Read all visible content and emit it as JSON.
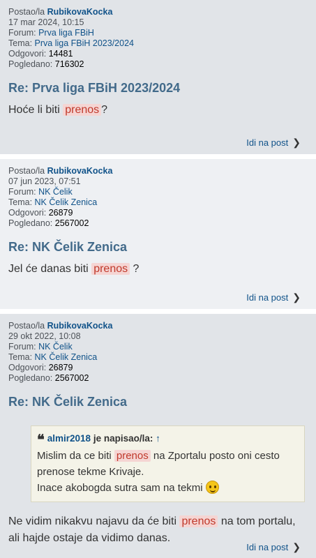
{
  "posts": [
    {
      "author_prefix": "Postao/la",
      "author": "RubikovaKocka",
      "date": "17 mar 2024, 10:15",
      "forum_label": "Forum:",
      "forum": "Prva liga FBiH",
      "topic_label": "Tema:",
      "topic": "Prva liga FBiH 2023/2024",
      "replies_label": "Odgovori:",
      "replies": "14481",
      "views_label": "Pogledano:",
      "views": "716302",
      "title": "Re: Prva liga FBiH 2023/2024",
      "text_before": "Hoće li biti ",
      "highlight": "prenos",
      "text_after": "?",
      "goto": "Idi na post"
    },
    {
      "author_prefix": "Postao/la",
      "author": "RubikovaKocka",
      "date": "07 jun 2023, 07:51",
      "forum_label": "Forum:",
      "forum": "NK Čelik",
      "topic_label": "Tema:",
      "topic": "NK Čelik Zenica",
      "replies_label": "Odgovori:",
      "replies": "26879",
      "views_label": "Pogledano:",
      "views": "2567002",
      "title": "Re: NK Čelik Zenica",
      "text_before": "Jel će danas biti ",
      "highlight": "prenos",
      "text_after": " ?",
      "goto": "Idi na post"
    },
    {
      "author_prefix": "Postao/la",
      "author": "RubikovaKocka",
      "date": "29 okt 2022, 10:08",
      "forum_label": "Forum:",
      "forum": "NK Čelik",
      "topic_label": "Tema:",
      "topic": "NK Čelik Zenica",
      "replies_label": "Odgovori:",
      "replies": "26879",
      "views_label": "Pogledano:",
      "views": "2567002",
      "title": "Re: NK Čelik Zenica",
      "quote": {
        "author": "almir2018",
        "wrote": "je napisao/la:",
        "arrow": "↑",
        "line1_before": "Mislim da ce biti ",
        "line1_highlight": "prenos",
        "line1_after": " na Zportalu posto oni cesto prenose tekme Krivaje.",
        "line2": "Inace akobogda sutra sam na tekmi "
      },
      "text_before": "Ne vidim nikakvu najavu da će biti ",
      "highlight": "prenos",
      "text_after": " na tom portalu, ali hajde ostaje da vidimo danas.",
      "goto": "Idi na post"
    }
  ],
  "icons": {
    "chevron": "chevron-right-icon",
    "quote": "quote-icon",
    "smiley": "wink-smiley-icon"
  }
}
